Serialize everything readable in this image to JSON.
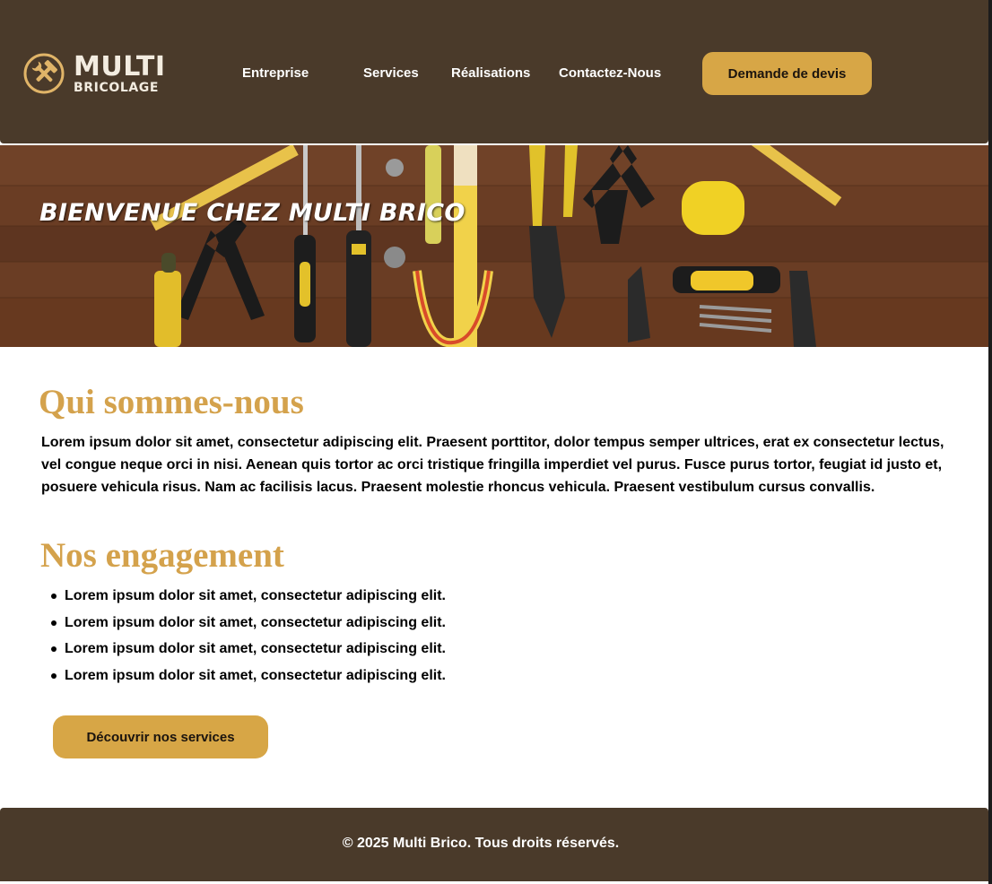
{
  "brand": {
    "logo_main": "MULTI",
    "logo_sub": "BRICOLAGE",
    "icon": "hammer-wrench-icon"
  },
  "nav": {
    "items": [
      {
        "label": "Entreprise"
      },
      {
        "label": "Services"
      },
      {
        "label": "Réalisations"
      },
      {
        "label": "Contactez-Nous"
      }
    ],
    "cta_label": "Demande de devis"
  },
  "hero": {
    "title": "BIENVENUE CHEZ MULTI BRICO"
  },
  "about": {
    "title": "Qui sommes-nous",
    "text": "Lorem ipsum dolor sit amet, consectetur adipiscing elit. Praesent porttitor, dolor tempus semper ultrices, erat ex consectetur lectus, vel congue neque orci in nisi. Aenean quis tortor ac orci tristique fringilla imperdiet vel purus. Fusce purus tortor, feugiat id justo et, posuere vehicula risus. Nam ac facilisis lacus. Praesent molestie rhoncus vehicula. Praesent vestibulum cursus convallis."
  },
  "commitments": {
    "title": "Nos engagement",
    "items": [
      "Lorem ipsum dolor sit amet, consectetur adipiscing elit.",
      "Lorem ipsum dolor sit amet, consectetur adipiscing elit.",
      "Lorem ipsum dolor sit amet, consectetur adipiscing elit.",
      "Lorem ipsum dolor sit amet, consectetur adipiscing elit."
    ],
    "cta_label": "Découvrir nos services"
  },
  "footer": {
    "text": "© 2025 Multi Brico. Tous droits réservés."
  },
  "colors": {
    "header_bg": "#4a3a2a",
    "accent": "#d7a646",
    "heading": "#d4a24c"
  }
}
